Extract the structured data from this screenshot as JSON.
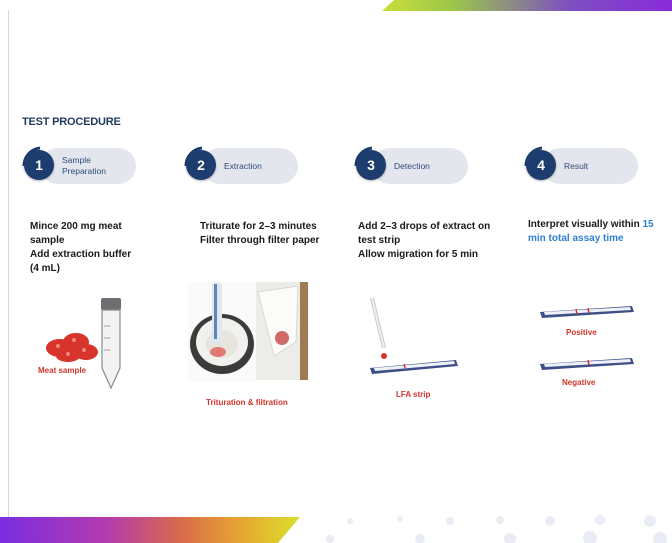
{
  "heading": "TEST PROCEDURE",
  "steps": [
    {
      "number": "1",
      "title": "Sample Preparation",
      "lines": [
        "Mince 200 mg meat",
        "sample",
        "Add extraction buffer",
        "(4 mL)"
      ],
      "caption": "Meat sample"
    },
    {
      "number": "2",
      "title": "Extraction",
      "lines": [
        "Triturate for 2–3 minutes",
        "Filter through filter paper"
      ],
      "caption": "Trituration & filtration"
    },
    {
      "number": "3",
      "title": "Detection",
      "lines": [
        "Add 2–3 drops of extract on",
        "test strip",
        "Allow migration for 5 min"
      ],
      "caption": "LFA strip"
    },
    {
      "number": "4",
      "title": "Result",
      "line1": "Interpret visually within",
      "highlight1": "15",
      "highlight2": "min total assay time",
      "captions": [
        "Positive",
        "Negative"
      ]
    }
  ],
  "colors": {
    "badge": "#1d3d6e",
    "pill": "#e3e6ec",
    "caption_red": "#d2332c",
    "highlight_blue": "#2f7fd0"
  }
}
